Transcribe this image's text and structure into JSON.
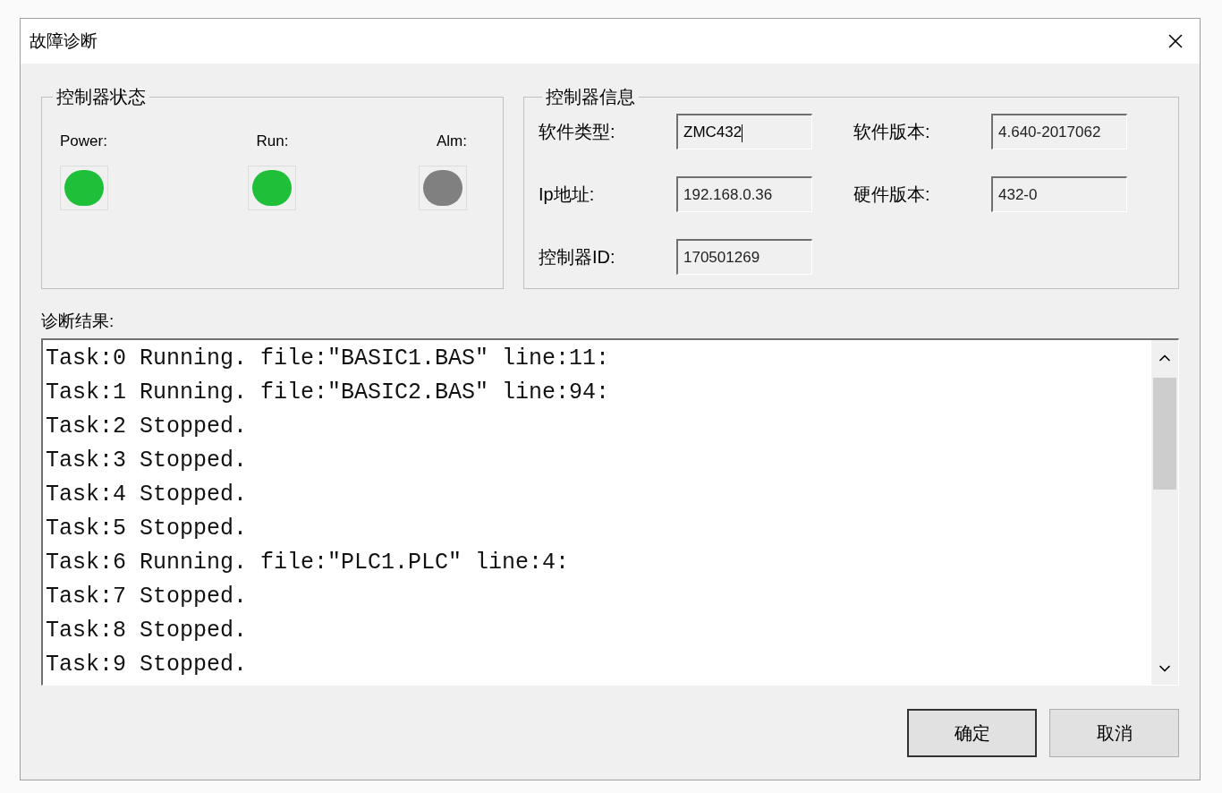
{
  "window": {
    "title": "故障诊断"
  },
  "controller_status": {
    "title": "控制器状态",
    "leds": [
      {
        "label": "Power:",
        "color": "#1fbf3a"
      },
      {
        "label": "Run:",
        "color": "#1fbf3a"
      },
      {
        "label": "Alm:",
        "color": "#808080"
      }
    ]
  },
  "controller_info": {
    "title": "控制器信息",
    "fields": [
      {
        "label": "软件类型:",
        "value": "ZMC432",
        "focused": true
      },
      {
        "label": "软件版本:",
        "value": "4.640-2017062",
        "focused": false
      },
      {
        "label": "Ip地址:",
        "value": "192.168.0.36",
        "focused": false
      },
      {
        "label": "硬件版本:",
        "value": "432-0",
        "focused": false
      },
      {
        "label": "控制器ID:",
        "value": "170501269",
        "focused": false
      }
    ]
  },
  "diagnosis": {
    "label": "诊断结果:",
    "lines": [
      "Task:0 Running. file:\"BASIC1.BAS\" line:11:",
      "Task:1 Running. file:\"BASIC2.BAS\" line:94:",
      "Task:2 Stopped.",
      "Task:3 Stopped.",
      "Task:4 Stopped.",
      "Task:5 Stopped.",
      "Task:6 Running. file:\"PLC1.PLC\" line:4:",
      "Task:7 Stopped.",
      "Task:8 Stopped.",
      "Task:9 Stopped."
    ]
  },
  "buttons": [
    {
      "label": "确定",
      "default": true
    },
    {
      "label": "取消",
      "default": false
    }
  ]
}
